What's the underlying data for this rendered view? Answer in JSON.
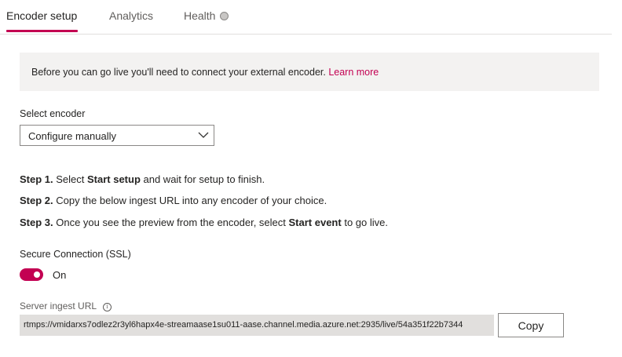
{
  "tabs": {
    "encoder_setup": "Encoder setup",
    "analytics": "Analytics",
    "health": "Health"
  },
  "notice": {
    "text": "Before you can go live you'll need to connect your external encoder. ",
    "link": "Learn more"
  },
  "encoder": {
    "label": "Select encoder",
    "selected": "Configure manually"
  },
  "steps": {
    "s1_prefix": "Step 1.",
    "s1_a": " Select ",
    "s1_bold": "Start setup",
    "s1_b": " and wait for setup to finish.",
    "s2_prefix": "Step 2.",
    "s2_text": " Copy the below ingest URL into any encoder of your choice.",
    "s3_prefix": "Step 3.",
    "s3_a": " Once you see the preview from the encoder, select ",
    "s3_bold": "Start event",
    "s3_b": " to go live."
  },
  "ssl": {
    "label": "Secure Connection (SSL)",
    "state": "On",
    "enabled": true
  },
  "ingest": {
    "label": "Server ingest URL",
    "url": "rtmps://vmidarxs7odlez2r3yl6hapx4e-streamaase1su011-aase.channel.media.azure.net:2935/live/54a351f22b7344",
    "copy_label": "Copy"
  },
  "colors": {
    "accent": "#c30052",
    "field_bg": "#e1dfdd",
    "notice_bg": "#f3f2f1"
  }
}
